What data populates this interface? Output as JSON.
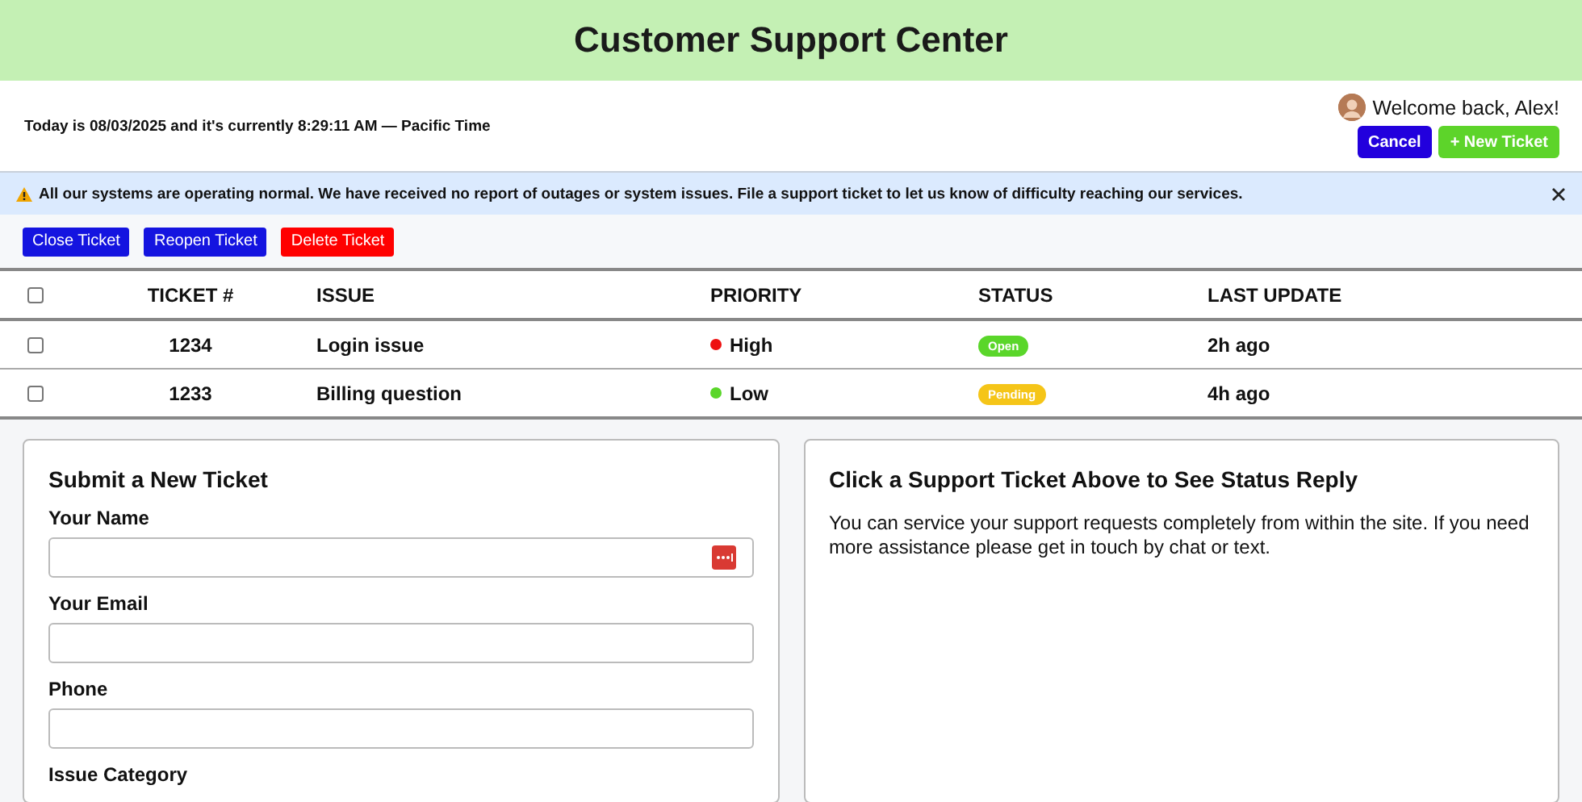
{
  "header": {
    "title": "Customer Support Center"
  },
  "info_bar": {
    "datetime": "Today is 08/03/2025 and it's currently 8:29:11 AM — Pacific Time",
    "welcome": "Welcome back, Alex!",
    "buttons": [
      {
        "label": "Cancel",
        "kind": "cancel"
      },
      {
        "label": "+ New Ticket",
        "kind": "new"
      }
    ]
  },
  "alert": {
    "message": "All our systems are operating normal. We have received no report of outages or system issues. File a support ticket to let us know of difficulty reaching our services."
  },
  "actions": [
    {
      "label": "Close Ticket",
      "kind": "primary"
    },
    {
      "label": "Reopen Ticket",
      "kind": "primary"
    },
    {
      "label": "Delete Ticket",
      "kind": "danger"
    }
  ],
  "table": {
    "select_all_checked": false,
    "columns": [
      "TICKET #",
      "ISSUE",
      "PRIORITY",
      "STATUS",
      "LAST UPDATE"
    ],
    "rows": [
      {
        "checked": false,
        "ticket": "1234",
        "issue": "Login issue",
        "priority": {
          "label": "High",
          "color": "#ee1111"
        },
        "status": {
          "label": "Open",
          "color": "#5ad62a"
        },
        "updated": "2h ago"
      },
      {
        "checked": false,
        "ticket": "1233",
        "issue": "Billing question",
        "priority": {
          "label": "Low",
          "color": "#5ad62a"
        },
        "status": {
          "label": "Pending",
          "color": "#f5c518"
        },
        "updated": "4h ago"
      }
    ]
  },
  "form": {
    "title": "Submit a New Ticket",
    "fields": [
      {
        "label": "Your Name",
        "password_manager": true
      },
      {
        "label": "Your Email",
        "password_manager": false
      },
      {
        "label": "Phone",
        "password_manager": false
      }
    ],
    "next_label": "Issue Category"
  },
  "status_panel": {
    "title": "Click a Support Ticket Above to See Status Reply",
    "text": "You can service your support requests completely from within the site. If you need more assistance please get in touch by chat or text."
  }
}
